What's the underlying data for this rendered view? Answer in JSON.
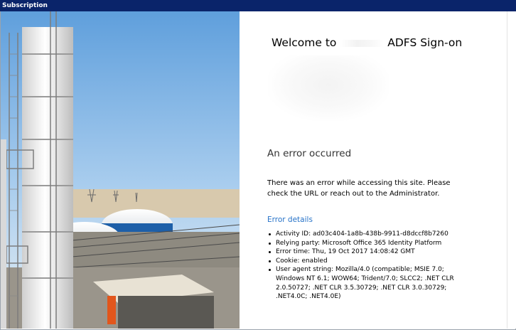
{
  "window": {
    "title": "Subscription"
  },
  "signon": {
    "welcome_prefix": "Welcome to",
    "welcome_suffix": "ADFS Sign-on"
  },
  "error": {
    "title": "An error occurred",
    "description": "There was an error while accessing this site. Please check the URL or reach out to the Administrator.",
    "details_link": "Error details",
    "details": [
      "Activity ID: ad03c404-1a8b-438b-9911-d8dccf8b7260",
      "Relying party: Microsoft Office 365 Identity Platform",
      "Error time: Thu, 19 Oct 2017 14:08:42 GMT",
      "Cookie: enabled",
      "User agent string: Mozilla/4.0 (compatible; MSIE 7.0; Windows NT 6.1; WOW64; Trident/7.0; SLCC2; .NET CLR 2.0.50727; .NET CLR 3.5.30729; .NET CLR 3.0.30729; .NET4.0C; .NET4.0E)"
    ]
  },
  "colors": {
    "titlebar": "#0a246a",
    "link": "#2672c8",
    "sky": "#8fbfe8"
  },
  "icons": {
    "illustration": "industrial-plant-photo"
  }
}
